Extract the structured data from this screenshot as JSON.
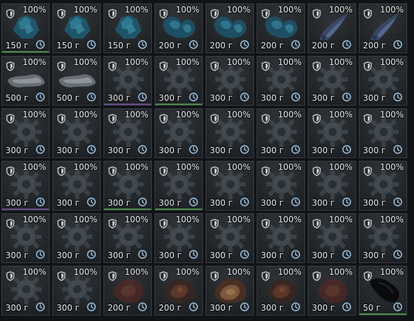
{
  "inventory": {
    "slots": [
      {
        "durability": "100%",
        "price": "150 г",
        "art": "crystal",
        "bar": "green"
      },
      {
        "durability": "100%",
        "price": "150 г",
        "art": "crystal",
        "bar": "none"
      },
      {
        "durability": "100%",
        "price": "150 г",
        "art": "crystal",
        "bar": "none"
      },
      {
        "durability": "100%",
        "price": "200 г",
        "art": "crystal-wide",
        "bar": "none"
      },
      {
        "durability": "100%",
        "price": "200 г",
        "art": "crystal-wide",
        "bar": "none"
      },
      {
        "durability": "100%",
        "price": "200 г",
        "art": "crystal-wide",
        "bar": "none"
      },
      {
        "durability": "100%",
        "price": "200 г",
        "art": "horn",
        "bar": "none"
      },
      {
        "durability": "100%",
        "price": "200 г",
        "art": "horn",
        "bar": "none"
      },
      {
        "durability": "100%",
        "price": "500 г",
        "art": "bone",
        "bar": "none"
      },
      {
        "durability": "100%",
        "price": "500 г",
        "art": "bone",
        "bar": "none"
      },
      {
        "durability": "100%",
        "price": "300 г",
        "art": "gear",
        "bar": "purple"
      },
      {
        "durability": "100%",
        "price": "300 г",
        "art": "gear",
        "bar": "green"
      },
      {
        "durability": "100%",
        "price": "300 г",
        "art": "gear",
        "bar": "none"
      },
      {
        "durability": "100%",
        "price": "300 г",
        "art": "gear",
        "bar": "none"
      },
      {
        "durability": "100%",
        "price": "300 г",
        "art": "gear",
        "bar": "none"
      },
      {
        "durability": "100%",
        "price": "300 г",
        "art": "gear",
        "bar": "none"
      },
      {
        "durability": "100%",
        "price": "300 г",
        "art": "gear",
        "bar": "none"
      },
      {
        "durability": "100%",
        "price": "300 г",
        "art": "gear",
        "bar": "none"
      },
      {
        "durability": "100%",
        "price": "300 г",
        "art": "gear",
        "bar": "none"
      },
      {
        "durability": "100%",
        "price": "300 г",
        "art": "gear",
        "bar": "none"
      },
      {
        "durability": "100%",
        "price": "300 г",
        "art": "gear",
        "bar": "none"
      },
      {
        "durability": "100%",
        "price": "300 г",
        "art": "gear",
        "bar": "none"
      },
      {
        "durability": "100%",
        "price": "300 г",
        "art": "gear",
        "bar": "none"
      },
      {
        "durability": "100%",
        "price": "300 г",
        "art": "gear",
        "bar": "none"
      },
      {
        "durability": "100%",
        "price": "300 г",
        "art": "gear",
        "bar": "purple"
      },
      {
        "durability": "100%",
        "price": "300 г",
        "art": "gear",
        "bar": "none"
      },
      {
        "durability": "100%",
        "price": "300 г",
        "art": "gear",
        "bar": "green"
      },
      {
        "durability": "100%",
        "price": "300 г",
        "art": "gear",
        "bar": "green"
      },
      {
        "durability": "100%",
        "price": "300 г",
        "art": "gear",
        "bar": "none"
      },
      {
        "durability": "100%",
        "price": "300 г",
        "art": "gear",
        "bar": "none"
      },
      {
        "durability": "100%",
        "price": "300 г",
        "art": "gear",
        "bar": "none"
      },
      {
        "durability": "100%",
        "price": "300 г",
        "art": "gear",
        "bar": "none"
      },
      {
        "durability": "100%",
        "price": "300 г",
        "art": "gear",
        "bar": "none"
      },
      {
        "durability": "100%",
        "price": "300 г",
        "art": "gear",
        "bar": "none"
      },
      {
        "durability": "100%",
        "price": "300 г",
        "art": "gear",
        "bar": "none"
      },
      {
        "durability": "100%",
        "price": "300 г",
        "art": "gear",
        "bar": "none"
      },
      {
        "durability": "100%",
        "price": "300 г",
        "art": "gear",
        "bar": "none"
      },
      {
        "durability": "100%",
        "price": "300 г",
        "art": "gear",
        "bar": "none"
      },
      {
        "durability": "100%",
        "price": "300 г",
        "art": "gear",
        "bar": "none"
      },
      {
        "durability": "100%",
        "price": "300 г",
        "art": "gear",
        "bar": "none"
      },
      {
        "durability": "100%",
        "price": "300 г",
        "art": "gear",
        "bar": "none"
      },
      {
        "durability": "100%",
        "price": "300 г",
        "art": "gear",
        "bar": "none"
      },
      {
        "durability": "100%",
        "price": "200 г",
        "art": "ember",
        "bar": "none"
      },
      {
        "durability": "100%",
        "price": "200 г",
        "art": "ember-dark",
        "bar": "none"
      },
      {
        "durability": "100%",
        "price": "300 г",
        "art": "ember-bright",
        "bar": "none"
      },
      {
        "durability": "100%",
        "price": "300 г",
        "art": "ember-dark",
        "bar": "none"
      },
      {
        "durability": "100%",
        "price": "300 г",
        "art": "ember",
        "bar": "none"
      },
      {
        "durability": "100%",
        "price": "50 г",
        "art": "dark-shard",
        "bar": "green"
      }
    ]
  }
}
